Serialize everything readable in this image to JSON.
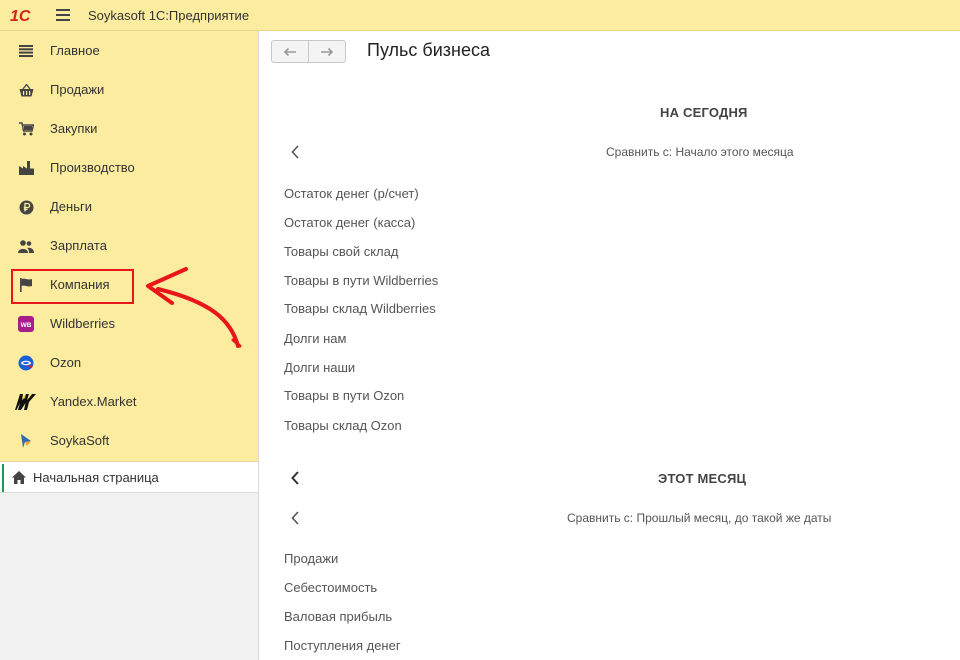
{
  "app": {
    "title": "Soykasoft 1С:Предприятие",
    "logo_text": "1С"
  },
  "sidebar": {
    "items": [
      {
        "label": "Главное",
        "icon": "list-icon"
      },
      {
        "label": "Продажи",
        "icon": "basket-icon"
      },
      {
        "label": "Закупки",
        "icon": "cart-icon"
      },
      {
        "label": "Производство",
        "icon": "factory-icon"
      },
      {
        "label": "Деньги",
        "icon": "ruble-coin-icon"
      },
      {
        "label": "Зарплата",
        "icon": "people-icon"
      },
      {
        "label": "Компания",
        "icon": "flag-icon"
      },
      {
        "label": "Wildberries",
        "icon": "wildberries-logo-icon",
        "badge": "WB"
      },
      {
        "label": "Ozon",
        "icon": "ozon-logo-icon"
      },
      {
        "label": "Yandex.Market",
        "icon": "yandex-market-logo-icon"
      },
      {
        "label": "SoykaSoft",
        "icon": "soykasoft-logo-icon"
      }
    ],
    "home": {
      "label": "Начальная страница",
      "icon": "home-icon"
    }
  },
  "main": {
    "title": "Пульс бизнеса",
    "sections": [
      {
        "title": "НА СЕГОДНЯ",
        "compare": "Сравнить с: Начало этого месяца",
        "metrics": [
          "Остаток денег (р/счет)",
          "Остаток денег (касса)",
          "Товары свой склад",
          "Товары в пути Wildberries",
          "Товары склад Wildberries",
          "Долги нам",
          "Долги наши",
          "Товары в пути Ozon",
          "Товары склад Ozon"
        ]
      },
      {
        "title": "ЭТОТ МЕСЯЦ",
        "compare": "Сравнить с: Прошлый месяц, до такой же даты",
        "metrics": [
          "Продажи",
          "Себестоимость",
          "Валовая прибыль",
          "Поступления денег"
        ]
      }
    ]
  },
  "colors": {
    "sidebar_bg": "#fbeca0",
    "highlight": "#e8161a",
    "home_accent": "#1f9a52",
    "logo_red": "#d9221c"
  }
}
